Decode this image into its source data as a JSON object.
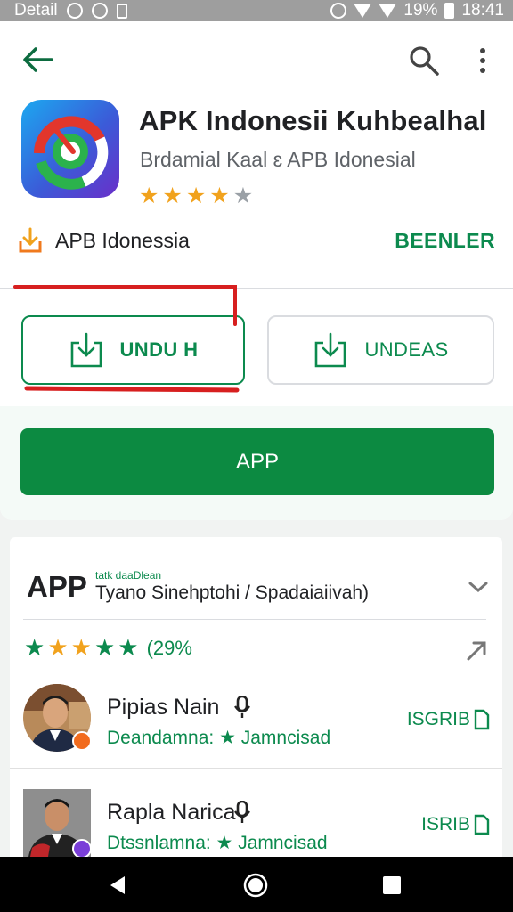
{
  "status_bar": {
    "left_text": "Detail",
    "battery": "19%",
    "time": "18:41"
  },
  "app": {
    "title": "APK Indonesii Kuhbealhal",
    "subtitle": "Brdamial Kaal  ɛ APB Idonesial",
    "rating_stars": 4,
    "developer": "APB Idonessia",
    "developer_action": "BEENLER"
  },
  "buttons": {
    "unduh": "UNDU H",
    "undeas": "UNDEAS",
    "app": "APP"
  },
  "reviews_section": {
    "title": "APP",
    "tag": "tatk daaDlean",
    "subtitle": "Tyano Sinehptohi / Spadaiaiivah)",
    "rating_pct": "(29%",
    "items": [
      {
        "name": "Pipias Nain",
        "meta": "Deandamna: ★ Jamncisad",
        "side": "ISGRIB"
      },
      {
        "name": "Rapla Narica",
        "meta": "Dtssnlamna: ★ Jamncisad",
        "side": "ISRIB"
      }
    ]
  },
  "colors": {
    "accent_green": "#0c8a4e",
    "install_green": "#0c8a41",
    "star_orange": "#f1a21d",
    "highlight_red": "#d71f1f"
  }
}
